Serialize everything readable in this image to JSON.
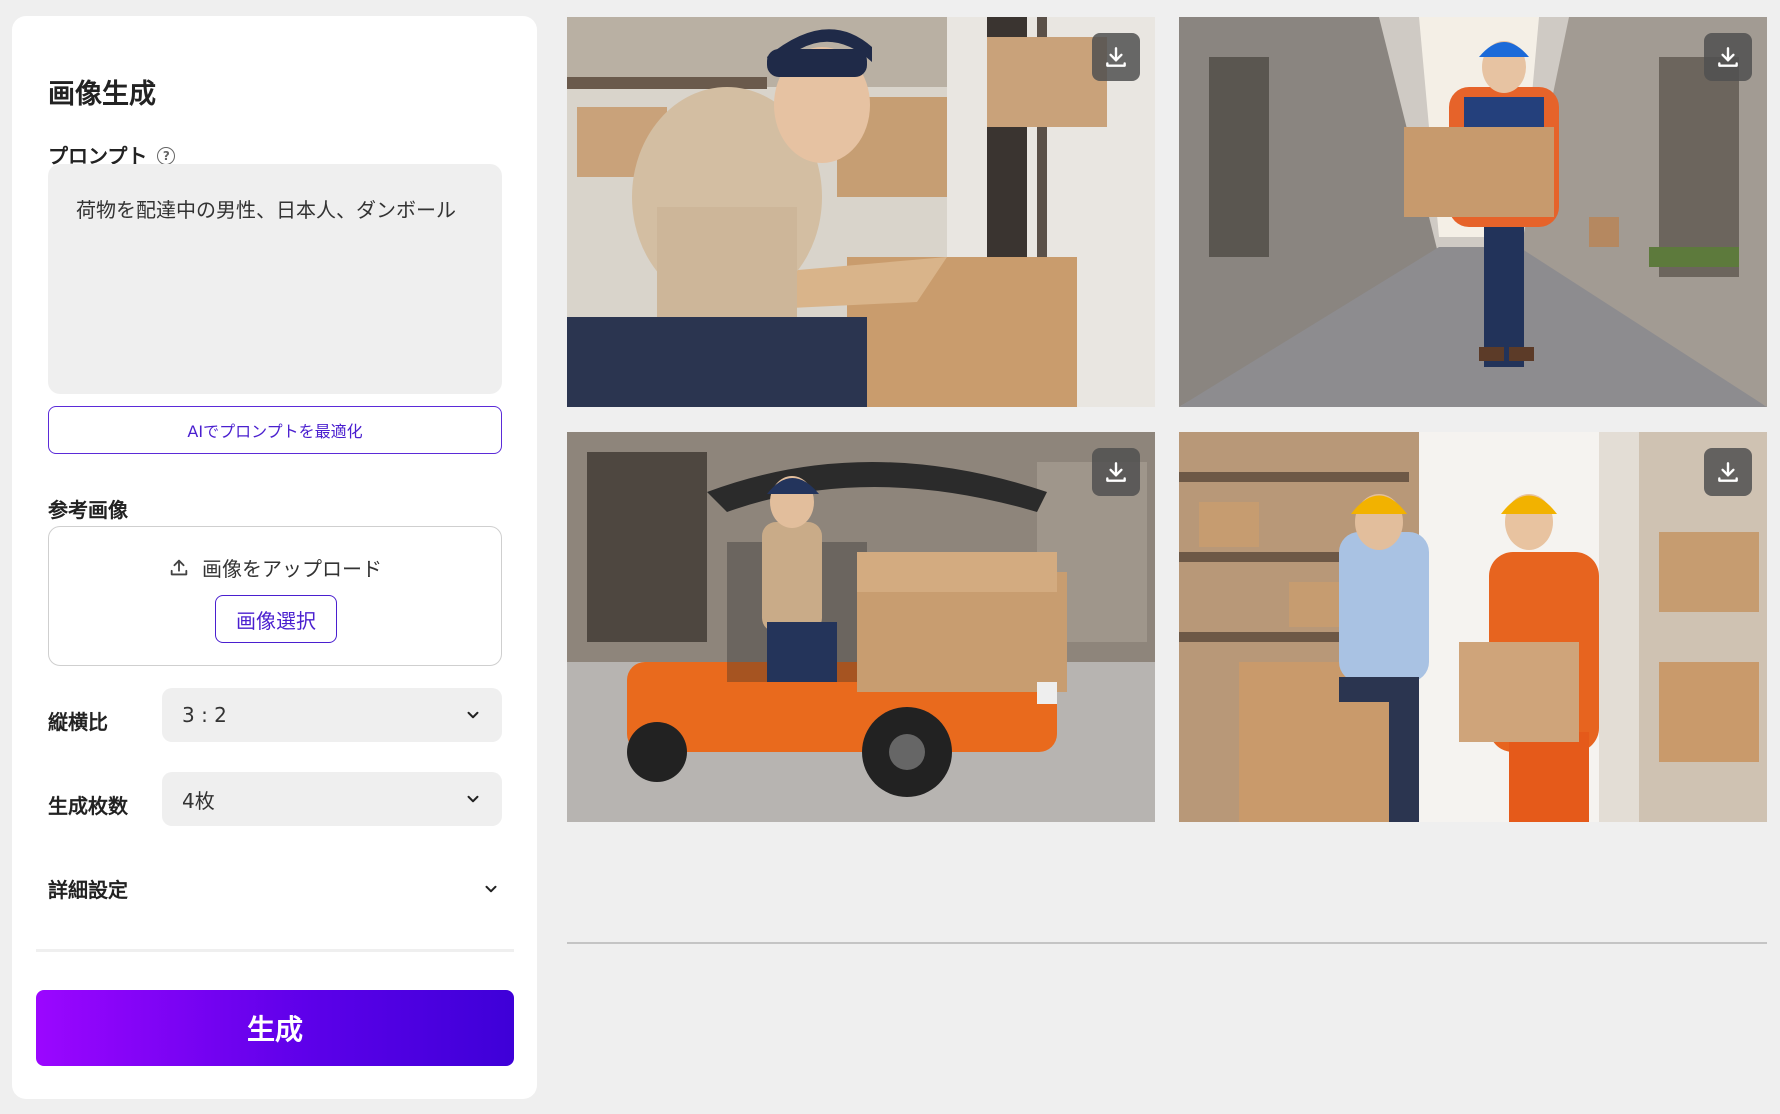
{
  "panel": {
    "title": "画像生成",
    "prompt_label": "プロンプト",
    "help_glyph": "?",
    "prompt_text": "荷物を配達中の男性、日本人、ダンボール",
    "optimize_label": "AIでプロンプトを最適化",
    "reference_label": "参考画像",
    "upload_label": "画像をアップロード",
    "select_image_label": "画像選択",
    "aspect_label": "縦横比",
    "aspect_value": "3 : 2",
    "count_label": "生成枚数",
    "count_value": "4枚",
    "advanced_label": "詳細設定",
    "generate_label": "生成"
  },
  "gallery": {
    "images": [
      {
        "subject": "man-opening-cardboard-box-indoors",
        "icon": "download-icon"
      },
      {
        "subject": "delivery-man-carrying-box-in-alley",
        "icon": "download-icon"
      },
      {
        "subject": "man-on-orange-delivery-cart-with-boxes",
        "icon": "download-icon"
      },
      {
        "subject": "two-workers-handing-over-boxes",
        "icon": "download-icon"
      }
    ]
  },
  "colors": {
    "accent": "#4a1fcf",
    "generate_gradient_start": "#9b06ff",
    "generate_gradient_end": "#3e00d8",
    "background": "#efefef"
  }
}
